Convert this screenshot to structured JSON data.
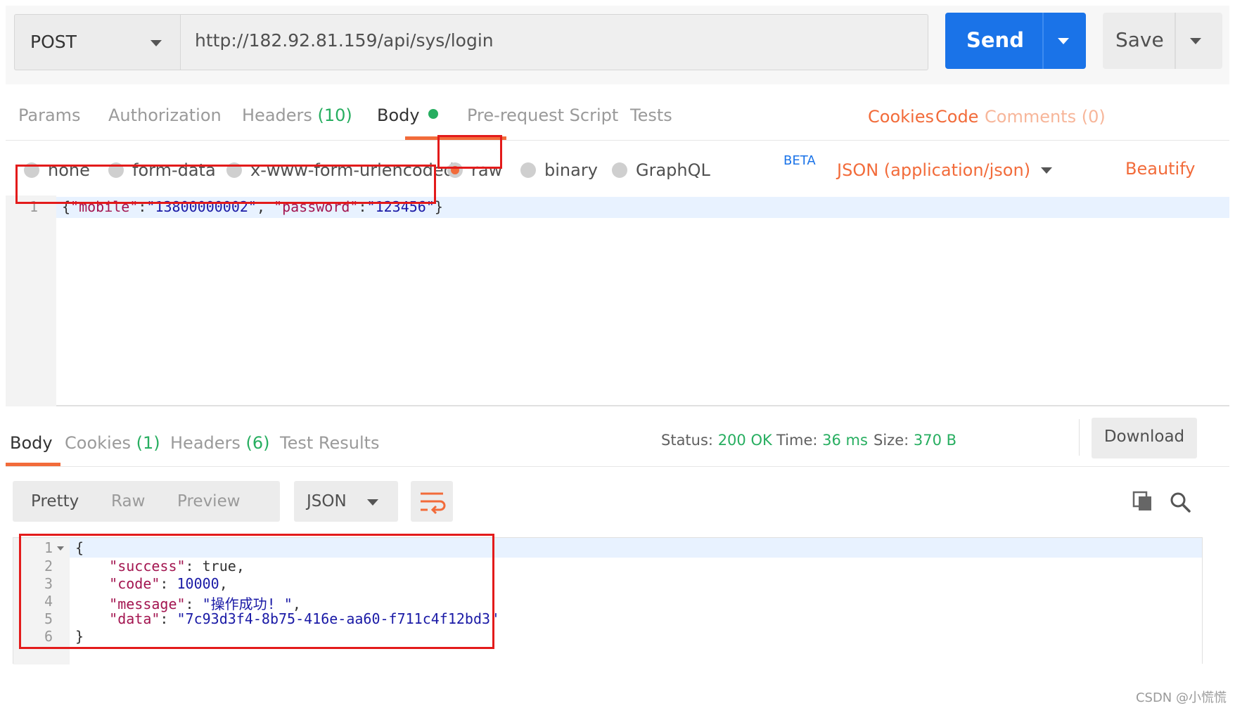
{
  "request": {
    "method": "POST",
    "url": "http://182.92.81.159/api/sys/login",
    "send_label": "Send",
    "save_label": "Save"
  },
  "request_tabs": {
    "params": "Params",
    "authorization": "Authorization",
    "headers": "Headers",
    "headers_count": "(10)",
    "body": "Body",
    "prerequest": "Pre-request Script",
    "tests": "Tests",
    "cookies": "Cookies",
    "code": "Code",
    "comments": "Comments (0)"
  },
  "body_types": {
    "none": "none",
    "form_data": "form-data",
    "urlencoded": "x-www-form-urlencoded",
    "raw": "raw",
    "binary": "binary",
    "graphql": "GraphQL",
    "beta": "BETA",
    "selected": "raw",
    "content_type": "JSON (application/json)",
    "beautify": "Beautify"
  },
  "request_body": {
    "line_number": "1",
    "open_brace": "{",
    "key1": "\"mobile\"",
    "colon1": ":",
    "val1": "\"13800000002\"",
    "comma": ", ",
    "key2": "\"password\"",
    "colon2": ":",
    "val2": "\"123456\"",
    "close_brace": "}"
  },
  "response_tabs": {
    "body": "Body",
    "cookies": "Cookies",
    "cookies_count": "(1)",
    "headers": "Headers",
    "headers_count": "(6)",
    "test_results": "Test Results"
  },
  "response_meta": {
    "status_label": "Status:",
    "status_value": "200 OK",
    "time_label": "Time:",
    "time_value": "36 ms",
    "size_label": "Size:",
    "size_value": "370 B",
    "download": "Download"
  },
  "response_view": {
    "pretty": "Pretty",
    "raw": "Raw",
    "preview": "Preview",
    "format": "JSON"
  },
  "response_body": {
    "line_numbers": [
      "1",
      "2",
      "3",
      "4",
      "5",
      "6"
    ],
    "open_brace": "{",
    "success_key": "\"success\"",
    "success_val": "true",
    "code_key": "\"code\"",
    "code_val": "10000",
    "message_key": "\"message\"",
    "message_val": "\"操作成功! \"",
    "data_key": "\"data\"",
    "data_val": "\"7c93d3f4-8b75-416e-aa60-f711c4f12bd3\"",
    "close_brace": "}"
  },
  "watermark": "CSDN @小慌慌",
  "colors": {
    "accent_orange": "#f26b3a",
    "send_blue": "#1a73e8",
    "status_green": "#27ae60",
    "highlight_red": "#e31b1b"
  }
}
